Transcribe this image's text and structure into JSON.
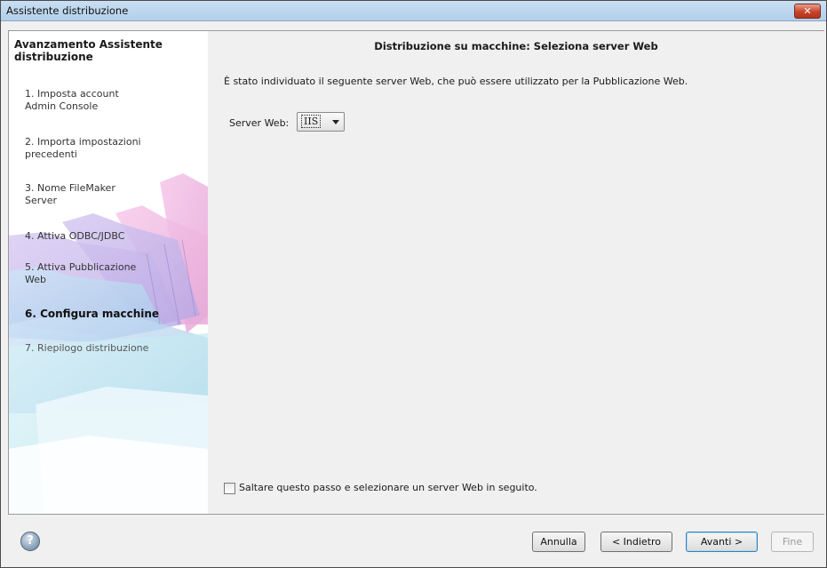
{
  "window": {
    "title": "Assistente distribuzione",
    "close_label": "✕"
  },
  "sidebar": {
    "header": "Avanzamento Assistente distribuzione",
    "steps": [
      {
        "label": "1. Imposta account\nAdmin Console"
      },
      {
        "label": "2. Importa impostazioni\nprecedenti"
      },
      {
        "label": "3. Nome FileMaker\nServer"
      },
      {
        "label": "4. Attiva ODBC/JDBC"
      },
      {
        "label": "5. Attiva Pubblicazione\nWeb"
      },
      {
        "label": "6. Configura macchine"
      },
      {
        "label": "7. Riepilogo distribuzione"
      }
    ],
    "current_step": 6
  },
  "main": {
    "title": "Distribuzione su macchine: Seleziona server Web",
    "description": "È stato individuato il seguente server Web, che può essere utilizzato per la Pubblicazione Web.",
    "server_web_label": "Server Web:",
    "server_web_value": "IIS",
    "skip_label": "Saltare questo passo e selezionare un server Web in seguito.",
    "skip_checked": false
  },
  "footer": {
    "help_icon": "question-mark-icon",
    "help_glyph": "?",
    "cancel_label": "Annulla",
    "back_label": "< Indietro",
    "next_label": "Avanti >",
    "finish_label": "Fine"
  }
}
